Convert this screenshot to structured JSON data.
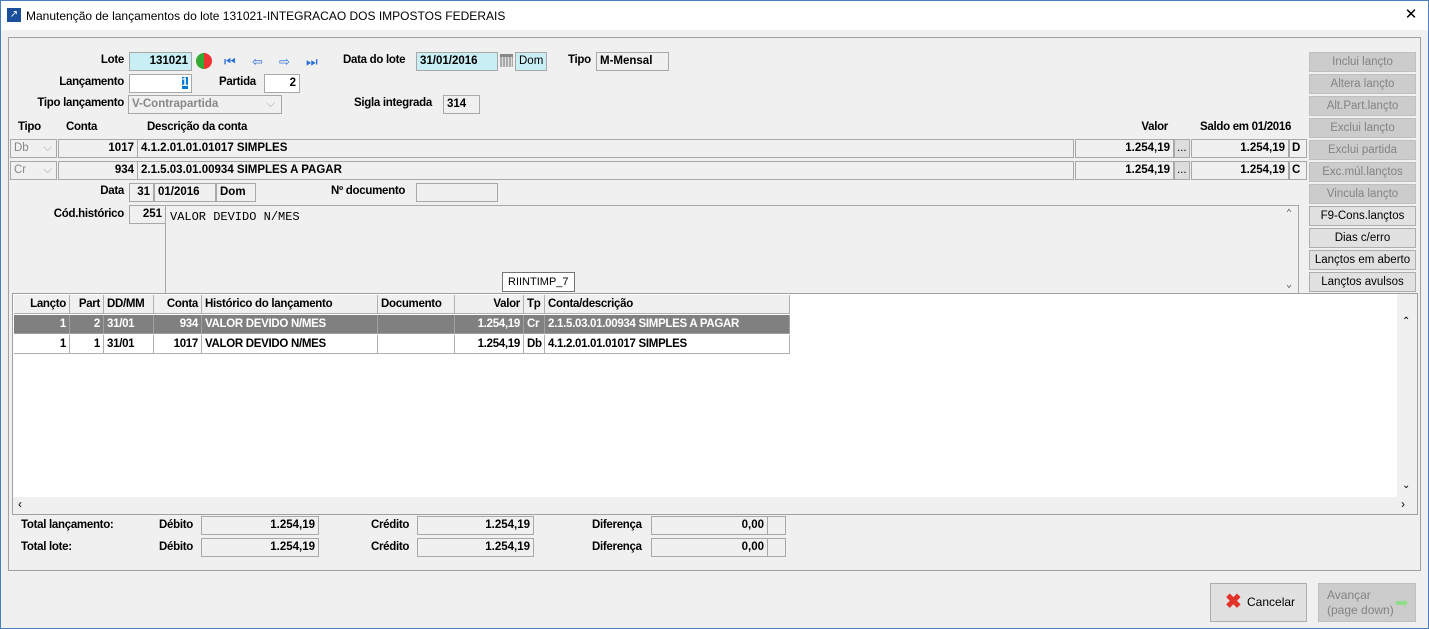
{
  "window": {
    "title": "Manutenção de lançamentos do lote 131021-INTEGRACAO DOS IMPOSTOS FEDERAIS",
    "close": "✕"
  },
  "header": {
    "lote_label": "Lote",
    "lote": "131021",
    "data_lote_label": "Data do lote",
    "data_lote": "31/01/2016",
    "data_lote_dia": "Dom",
    "tipo_label": "Tipo",
    "tipo": "M-Mensal",
    "lancamento_label": "Lançamento",
    "lancamento": "1",
    "partida_label": "Partida",
    "partida": "2",
    "tipo_lanc_label": "Tipo lançamento",
    "tipo_lanc": "V-Contrapartida",
    "sigla_label": "Sigla integrada",
    "sigla": "314"
  },
  "partidas": {
    "cols": {
      "tipo": "Tipo",
      "conta": "Conta",
      "descricao": "Descrição da conta",
      "valor": "Valor",
      "saldo": "Saldo em 01/2016"
    },
    "rows": [
      {
        "tipo": "Db",
        "conta": "1017",
        "descricao": "4.1.2.01.01.01017 SIMPLES",
        "valor": "1.254,19",
        "saldo": "1.254,19",
        "dc": "D"
      },
      {
        "tipo": "Cr",
        "conta": "934",
        "descricao": "2.1.5.03.01.00934 SIMPLES A PAGAR",
        "valor": "1.254,19",
        "saldo": "1.254,19",
        "dc": "C"
      }
    ],
    "ellipsis": "..."
  },
  "detalhe": {
    "data_label": "Data",
    "dia": "31",
    "mes_ano": "01/2016",
    "dia_semana": "Dom",
    "doc_label": "Nº documento",
    "doc": "",
    "cod_hist_label": "Cód.histórico",
    "cod_hist": "251",
    "historico": "VALOR DEVIDO N/MES",
    "tooltip": "RIINTIMP_7"
  },
  "actions": [
    {
      "label": "Inclui lançto",
      "enabled": false
    },
    {
      "label": "Altera lançto",
      "enabled": false
    },
    {
      "label": "Alt.Part.lançto",
      "enabled": false
    },
    {
      "label": "Exclui lançto",
      "enabled": false
    },
    {
      "label": "Exclui partida",
      "enabled": false
    },
    {
      "label": "Exc.múl.lançtos",
      "enabled": false
    },
    {
      "label": "Vincula lançto",
      "enabled": false
    },
    {
      "label": "F9-Cons.lançtos",
      "enabled": true
    },
    {
      "label": "Dias c/erro",
      "enabled": true
    },
    {
      "label": "Lançtos em aberto",
      "enabled": true
    },
    {
      "label": "Lançtos avulsos",
      "enabled": true
    }
  ],
  "grid": {
    "cols": [
      "Lançto",
      "Part",
      "DD/MM",
      "Conta",
      "Histórico do lançamento",
      "Documento",
      "Valor",
      "Tp",
      "Conta/descrição"
    ],
    "rows": [
      [
        "1",
        "2",
        "31/01",
        "934",
        "VALOR DEVIDO N/MES",
        "",
        "1.254,19",
        "Cr",
        "2.1.5.03.01.00934 SIMPLES A PAGAR"
      ],
      [
        "1",
        "1",
        "31/01",
        "1017",
        "VALOR DEVIDO N/MES",
        "",
        "1.254,19",
        "Db",
        "4.1.2.01.01.01017 SIMPLES"
      ]
    ]
  },
  "totais": {
    "debito_label": "Débito",
    "credito_label": "Crédito",
    "diferenca_label": "Diferença",
    "rows": [
      {
        "label": "Total lançamento:",
        "debito": "1.254,19",
        "credito": "1.254,19",
        "diferenca": "0,00"
      },
      {
        "label": "Total lote:",
        "debito": "1.254,19",
        "credito": "1.254,19",
        "diferenca": "0,00"
      }
    ]
  },
  "footer": {
    "cancelar": "Cancelar",
    "avancar": "Avançar",
    "avancar_sub": "(page down)"
  }
}
